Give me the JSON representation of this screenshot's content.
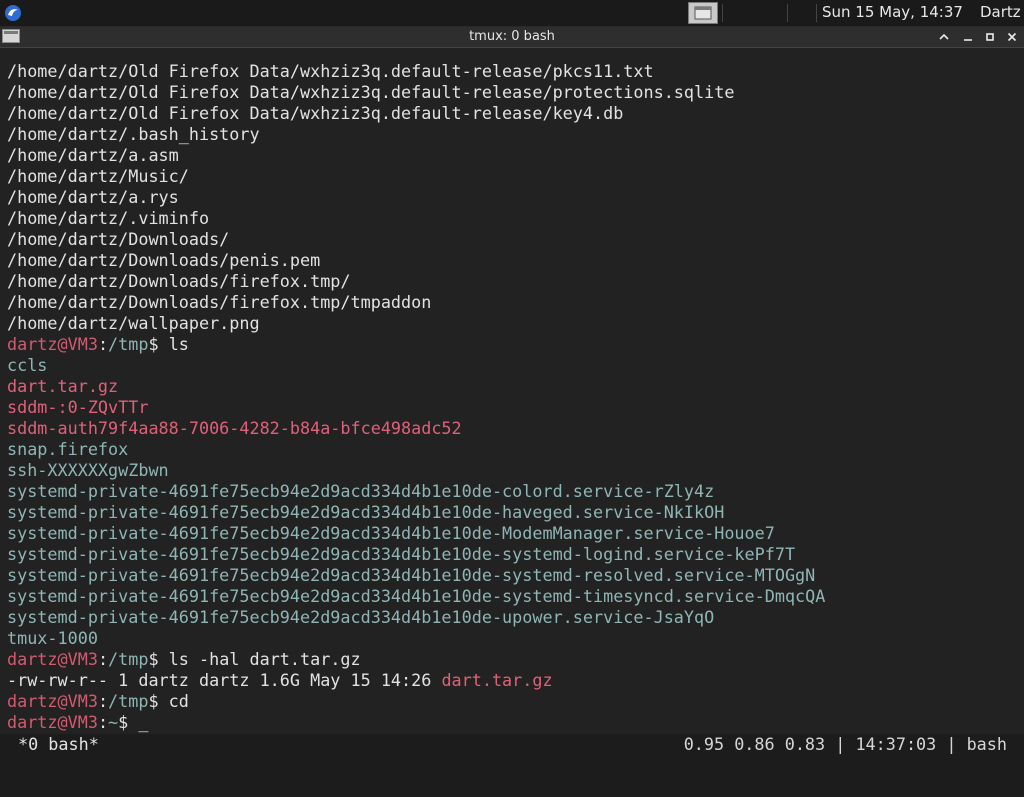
{
  "panel": {
    "clock": "Sun 15 May, 14:37",
    "user": "Dartz"
  },
  "window": {
    "title": "tmux: 0 bash"
  },
  "terminal": {
    "lines": [
      {
        "segments": [
          {
            "text": "/home/dartz/Old Firefox Data/wxhziz3q.default-release/pkcs11.txt",
            "class": "c-white"
          }
        ]
      },
      {
        "segments": [
          {
            "text": "/home/dartz/Old Firefox Data/wxhziz3q.default-release/protections.sqlite",
            "class": "c-white"
          }
        ]
      },
      {
        "segments": [
          {
            "text": "/home/dartz/Old Firefox Data/wxhziz3q.default-release/key4.db",
            "class": "c-white"
          }
        ]
      },
      {
        "segments": [
          {
            "text": "/home/dartz/.bash_history",
            "class": "c-white"
          }
        ]
      },
      {
        "segments": [
          {
            "text": "/home/dartz/a.asm",
            "class": "c-white"
          }
        ]
      },
      {
        "segments": [
          {
            "text": "/home/dartz/Music/",
            "class": "c-white"
          }
        ]
      },
      {
        "segments": [
          {
            "text": "/home/dartz/a.rys",
            "class": "c-white"
          }
        ]
      },
      {
        "segments": [
          {
            "text": "/home/dartz/.viminfo",
            "class": "c-white"
          }
        ]
      },
      {
        "segments": [
          {
            "text": "/home/dartz/Downloads/",
            "class": "c-white"
          }
        ]
      },
      {
        "segments": [
          {
            "text": "/home/dartz/Downloads/penis.pem",
            "class": "c-white"
          }
        ]
      },
      {
        "segments": [
          {
            "text": "/home/dartz/Downloads/firefox.tmp/",
            "class": "c-white"
          }
        ]
      },
      {
        "segments": [
          {
            "text": "/home/dartz/Downloads/firefox.tmp/tmpaddon",
            "class": "c-white"
          }
        ]
      },
      {
        "segments": [
          {
            "text": "/home/dartz/wallpaper.png",
            "class": "c-white"
          }
        ]
      },
      {
        "segments": [
          {
            "text": "dartz@VM3",
            "class": "user"
          },
          {
            "text": ":",
            "class": "sym"
          },
          {
            "text": "/tmp",
            "class": "path"
          },
          {
            "text": "$ ls",
            "class": "sym"
          }
        ]
      },
      {
        "segments": [
          {
            "text": "ccls",
            "class": "c-teal"
          }
        ]
      },
      {
        "segments": [
          {
            "text": "dart.tar.gz",
            "class": "c-pink"
          }
        ]
      },
      {
        "segments": [
          {
            "text": "sddm-:0-ZQvTTr",
            "class": "c-pink"
          }
        ]
      },
      {
        "segments": [
          {
            "text": "sddm-auth79f4aa88-7006-4282-b84a-bfce498adc52",
            "class": "c-pink"
          }
        ]
      },
      {
        "segments": [
          {
            "text": "snap.firefox",
            "class": "c-teal"
          }
        ]
      },
      {
        "segments": [
          {
            "text": "ssh-XXXXXXgwZbwn",
            "class": "c-teal"
          }
        ]
      },
      {
        "segments": [
          {
            "text": "systemd-private-4691fe75ecb94e2d9acd334d4b1e10de-colord.service-rZly4z",
            "class": "c-teal"
          }
        ]
      },
      {
        "segments": [
          {
            "text": "systemd-private-4691fe75ecb94e2d9acd334d4b1e10de-haveged.service-NkIkOH",
            "class": "c-teal"
          }
        ]
      },
      {
        "segments": [
          {
            "text": "systemd-private-4691fe75ecb94e2d9acd334d4b1e10de-ModemManager.service-Houoe7",
            "class": "c-teal"
          }
        ]
      },
      {
        "segments": [
          {
            "text": "systemd-private-4691fe75ecb94e2d9acd334d4b1e10de-systemd-logind.service-kePf7T",
            "class": "c-teal"
          }
        ]
      },
      {
        "segments": [
          {
            "text": "systemd-private-4691fe75ecb94e2d9acd334d4b1e10de-systemd-resolved.service-MTOGgN",
            "class": "c-teal"
          }
        ]
      },
      {
        "segments": [
          {
            "text": "systemd-private-4691fe75ecb94e2d9acd334d4b1e10de-systemd-timesyncd.service-DmqcQA",
            "class": "c-teal"
          }
        ]
      },
      {
        "segments": [
          {
            "text": "systemd-private-4691fe75ecb94e2d9acd334d4b1e10de-upower.service-JsaYqO",
            "class": "c-teal"
          }
        ]
      },
      {
        "segments": [
          {
            "text": "tmux-1000",
            "class": "c-teal"
          }
        ]
      },
      {
        "segments": [
          {
            "text": "dartz@VM3",
            "class": "user"
          },
          {
            "text": ":",
            "class": "sym"
          },
          {
            "text": "/tmp",
            "class": "path"
          },
          {
            "text": "$ ls -hal dart.tar.gz",
            "class": "sym"
          }
        ]
      },
      {
        "segments": [
          {
            "text": "-rw-rw-r-- 1 dartz dartz 1.6G May 15 14:26 ",
            "class": "c-white"
          },
          {
            "text": "dart.tar.gz",
            "class": "c-pink"
          }
        ]
      },
      {
        "segments": [
          {
            "text": "dartz@VM3",
            "class": "user"
          },
          {
            "text": ":",
            "class": "sym"
          },
          {
            "text": "/tmp",
            "class": "path"
          },
          {
            "text": "$ cd",
            "class": "sym"
          }
        ]
      },
      {
        "segments": [
          {
            "text": "dartz@VM3",
            "class": "user"
          },
          {
            "text": ":",
            "class": "sym"
          },
          {
            "text": "~",
            "class": "path"
          },
          {
            "text": "$ _",
            "class": "sym"
          }
        ]
      }
    ]
  },
  "tmux_status": {
    "window": "*0 bash*",
    "right": "0.95 0.86 0.83 | 14:37:03 | bash"
  }
}
